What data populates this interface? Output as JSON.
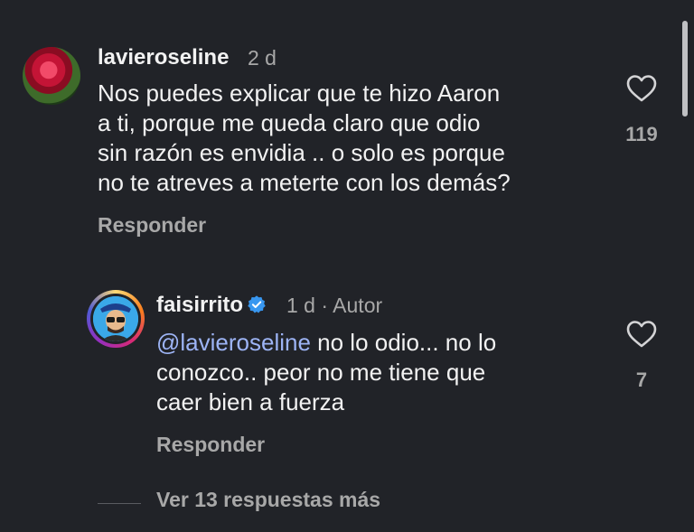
{
  "comments": [
    {
      "username": "lavieroseline",
      "time": "2 d",
      "text_lines": [
        "Nos puedes explicar que te hizo Aaron",
        "a ti, porque me queda claro que odio",
        "sin razón es envidia .. o solo es porque",
        "no te atreves  a meterte con los demás?"
      ],
      "likes": "119",
      "reply_label": "Responder"
    }
  ],
  "reply": {
    "username": "faisirrito",
    "time": "1 d",
    "separator": "·",
    "author_label": "Autor",
    "mention": "@lavieroseline",
    "text_line1_rest": " no lo odio... no lo",
    "text_line2": "conozco.. peor no me tiene que",
    "text_line3": "caer bien a fuerza",
    "likes": "7",
    "reply_label": "Responder"
  },
  "more_replies_label": "Ver 13 respuestas más",
  "icons": {
    "like": "heart-outline-icon",
    "verified": "verified-badge-icon"
  },
  "colors": {
    "background": "#212328",
    "text": "#f2f2f2",
    "muted": "#a8a8a8",
    "mention": "#9db4f5",
    "verified": "#3897f0"
  }
}
